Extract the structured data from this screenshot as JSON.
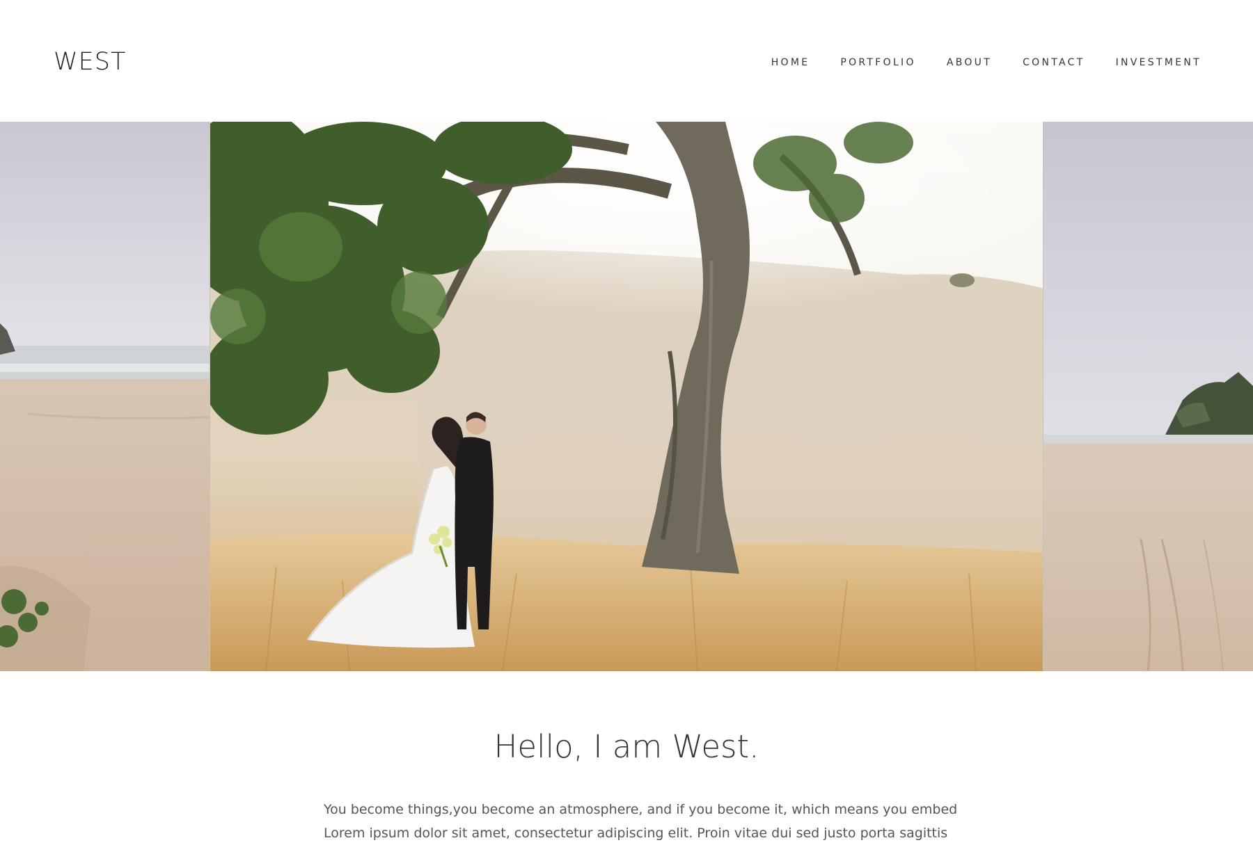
{
  "header": {
    "logo": "WEST",
    "nav": [
      {
        "label": "HOME"
      },
      {
        "label": "PORTFOLIO"
      },
      {
        "label": "ABOUT"
      },
      {
        "label": "CONTACT"
      },
      {
        "label": "INVESTMENT"
      }
    ]
  },
  "slider": {
    "slides": [
      {
        "subject": "beach-scene"
      },
      {
        "subject": "couple-under-oak-tree"
      },
      {
        "subject": "beach-scene"
      }
    ]
  },
  "intro": {
    "title": "Hello, I am West.",
    "lines": [
      "You become things,you become an atmosphere, and if you become it, which means you embed",
      "Lorem ipsum dolor sit amet, consectetur adipiscing elit. Proin vitae dui sed justo porta sagittis"
    ]
  },
  "colors": {
    "text": "#333333",
    "sand": "#d9c7b3",
    "sky": "#dcdce4",
    "grass": "#d8b98a",
    "foliage": "#3f5e2c"
  }
}
